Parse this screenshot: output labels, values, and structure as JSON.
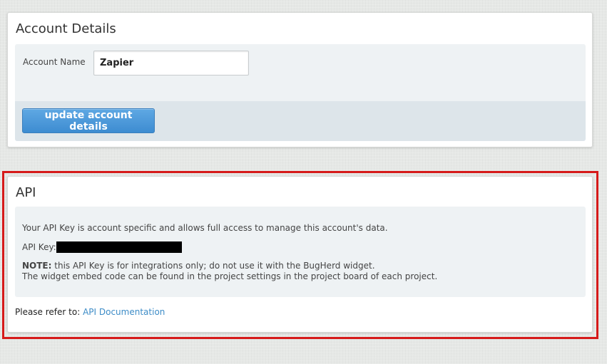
{
  "account": {
    "title": "Account Details",
    "name_label": "Account Name",
    "name_value": "Zapier",
    "update_label": "update account details"
  },
  "api": {
    "title": "API",
    "description": "Your API Key is account specific and allows full access to manage this account's data.",
    "key_label": "API Key:",
    "note_label": "NOTE:",
    "note_text": " this API Key is for integrations only; do not use it with the BugHerd widget.",
    "note_line2": "The widget embed code can be found in the project settings in the project board of each project.",
    "refer_label": "Please refer to: ",
    "doc_link": "API Documentation"
  },
  "colors": {
    "highlight_border": "#d61a1a",
    "button": "#4a96d8",
    "link": "#3d8cc7"
  }
}
